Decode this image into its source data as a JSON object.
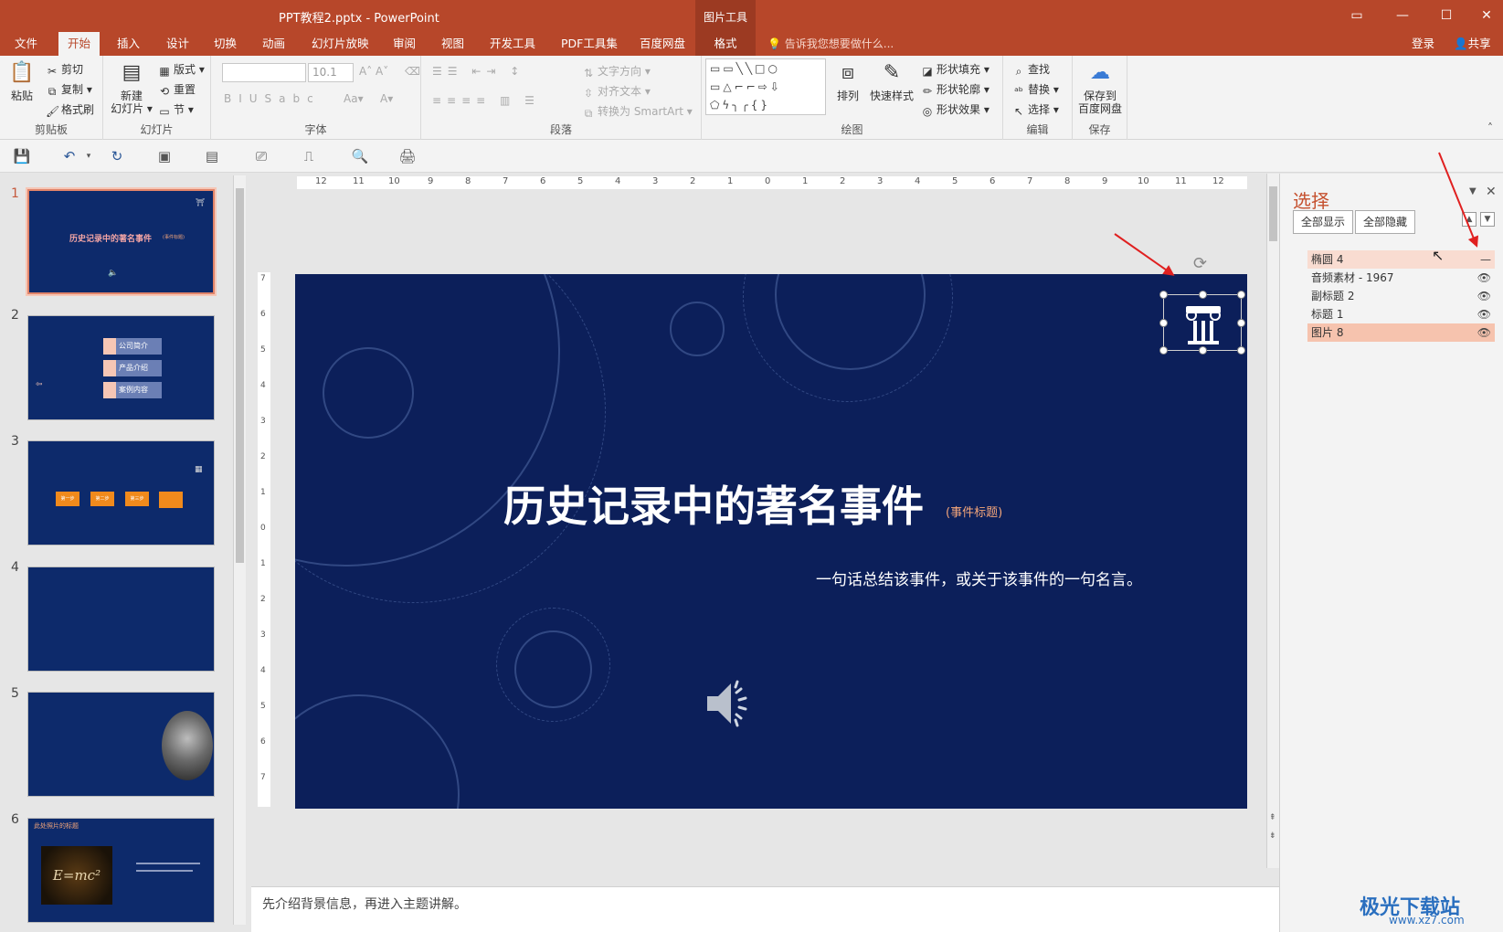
{
  "title_bar": {
    "doc_title": "PPT教程2.pptx - PowerPoint",
    "context_group": "图片工具",
    "window_buttons": [
      "restore-ribbon-icon",
      "minimize-icon",
      "maximize-icon",
      "close-icon"
    ]
  },
  "tabs": [
    "文件",
    "开始",
    "插入",
    "设计",
    "切换",
    "动画",
    "幻灯片放映",
    "审阅",
    "视图",
    "开发工具",
    "PDF工具集",
    "百度网盘",
    "格式"
  ],
  "active_tab": "开始",
  "tell_me": "告诉我您想要做什么...",
  "account": {
    "login": "登录",
    "share": "共享"
  },
  "ribbon": {
    "clipboard": {
      "paste": "粘贴",
      "cut": "剪切",
      "copy": "复制",
      "format_painter": "格式刷",
      "label": "剪贴板"
    },
    "slides": {
      "new_slide": "新建\n幻灯片",
      "new_slide_line1": "新建",
      "new_slide_line2": "幻灯片",
      "layout": "版式",
      "reset": "重置",
      "section": "节",
      "label": "幻灯片"
    },
    "font": {
      "font_name": "",
      "font_size": "10.1",
      "label": "字体"
    },
    "paragraph": {
      "text_direction": "文字方向",
      "align_text": "对齐文本",
      "convert_smartart": "转换为 SmartArt",
      "label": "段落"
    },
    "drawing": {
      "arrange": "排列",
      "quick_styles": "快速样式",
      "shape_fill": "形状填充",
      "shape_outline": "形状轮廓",
      "shape_effects": "形状效果",
      "label": "绘图"
    },
    "editing": {
      "find": "查找",
      "replace": "替换",
      "select": "选择",
      "label": "编辑"
    },
    "save": {
      "save_baidu_line1": "保存到",
      "save_baidu_line2": "百度网盘",
      "label": "保存"
    }
  },
  "thumbnails": [
    {
      "num": "1",
      "title": "历史记录中的著名事件",
      "tag": "(事件标题)"
    },
    {
      "num": "2",
      "items": [
        "公司简介",
        "产品介绍",
        "案例内容"
      ]
    },
    {
      "num": "3",
      "steps": [
        "第一步",
        "第二步",
        "第三步"
      ]
    },
    {
      "num": "4"
    },
    {
      "num": "5"
    },
    {
      "num": "6",
      "title": "此处照片的标题",
      "formula": "E=mc²"
    }
  ],
  "ruler": {
    "h_labels": [
      "12",
      "11",
      "10",
      "9",
      "8",
      "7",
      "6",
      "5",
      "4",
      "3",
      "2",
      "1",
      "0",
      "1",
      "2",
      "3",
      "4",
      "5",
      "6",
      "7",
      "8",
      "9",
      "10",
      "11",
      "12"
    ],
    "v_labels": [
      "7",
      "6",
      "5",
      "4",
      "3",
      "2",
      "1",
      "0",
      "1",
      "2",
      "3",
      "4",
      "5",
      "6",
      "7"
    ]
  },
  "slide": {
    "title": "历史记录中的著名事件",
    "tag": "(事件标题)",
    "subtitle": "一句话总结该事件，或关于该事件的一句名言。"
  },
  "notes": "先介绍背景信息，再进入主题讲解。",
  "selection_pane": {
    "title": "选择",
    "show_all": "全部显示",
    "hide_all": "全部隐藏",
    "items": [
      {
        "name": "椭圆 4",
        "visible": false,
        "state": "hover"
      },
      {
        "name": "音频素材 - 1967",
        "visible": true,
        "state": ""
      },
      {
        "name": "副标题 2",
        "visible": true,
        "state": ""
      },
      {
        "name": "标题 1",
        "visible": true,
        "state": ""
      },
      {
        "name": "图片 8",
        "visible": true,
        "state": "selected"
      }
    ]
  },
  "watermark": {
    "text": "极光下载站",
    "url": "www.xz7.com"
  },
  "colors": {
    "accent": "#b7472a",
    "slide_bg": "#0c1f5a",
    "pane_title": "#c5502e"
  }
}
